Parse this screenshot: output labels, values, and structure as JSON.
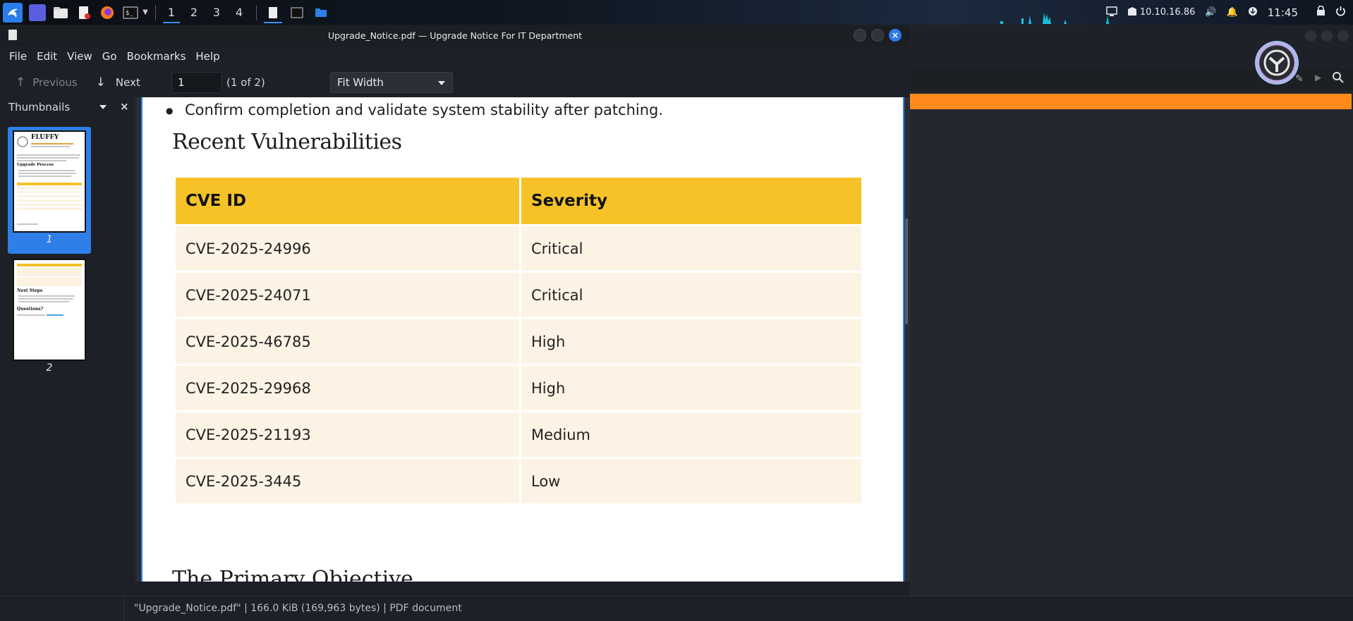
{
  "taskbar": {
    "workspaces": [
      "1",
      "2",
      "3",
      "4"
    ],
    "active_workspace": "1",
    "ip_address": "10.10.16.86",
    "clock": "11:45"
  },
  "window": {
    "title": "Upgrade_Notice.pdf — Upgrade Notice For IT Department"
  },
  "menu": {
    "file": "File",
    "edit": "Edit",
    "view": "View",
    "go": "Go",
    "bookmarks": "Bookmarks",
    "help": "Help"
  },
  "nav": {
    "previous": "Previous",
    "next": "Next",
    "page_value": "1",
    "page_count": "(1 of 2)",
    "zoom": "Fit Width"
  },
  "sidebar": {
    "title": "Thumbnails",
    "pages": [
      {
        "num": "1",
        "heading": "FLUFFY",
        "section": "Upgrade Process"
      },
      {
        "num": "2",
        "heading": "Next Steps",
        "section": "Questions?"
      }
    ]
  },
  "document": {
    "bullet": "Confirm completion and validate system stability after patching.",
    "heading": "Recent Vulnerabilities",
    "table_headers": [
      "CVE ID",
      "Severity"
    ],
    "rows": [
      {
        "cve": "CVE-2025-24996",
        "severity": "Critical"
      },
      {
        "cve": "CVE-2025-24071",
        "severity": "Critical"
      },
      {
        "cve": "CVE-2025-46785",
        "severity": "High"
      },
      {
        "cve": "CVE-2025-29968",
        "severity": "High"
      },
      {
        "cve": "CVE-2025-21193",
        "severity": "Medium"
      },
      {
        "cve": "CVE-2025-3445",
        "severity": "Low"
      }
    ],
    "next_heading_partial": "The Primary Objective"
  },
  "status": {
    "text": "\"Upgrade_Notice.pdf\"  |  166.0 KiB (169,963 bytes)  |  PDF document"
  },
  "colors": {
    "accent": "#2f7fe8",
    "table_header": "#f6c228",
    "table_row": "#fdf3e4",
    "orange_bar": "#ff8a1c"
  }
}
